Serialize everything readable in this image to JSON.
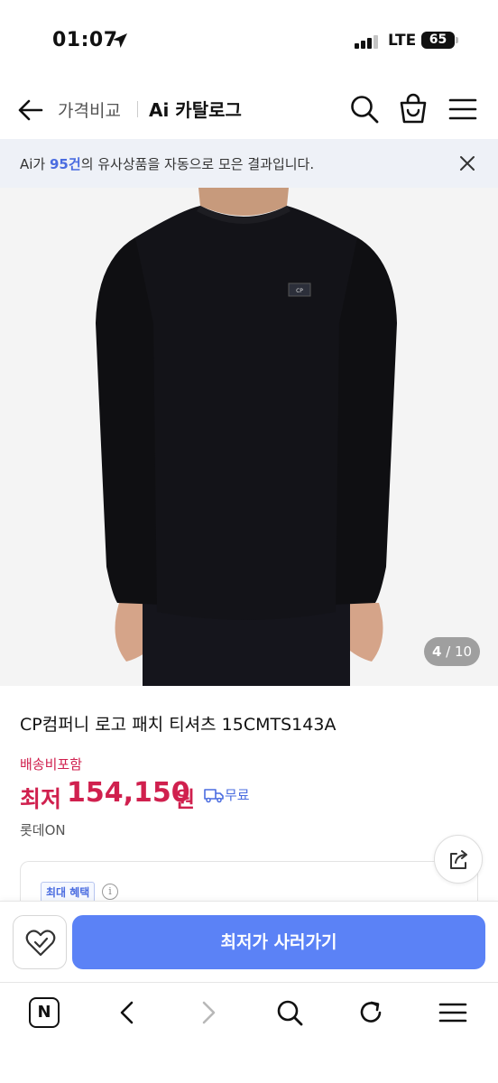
{
  "status_bar": {
    "time": "01:07",
    "network": "LTE",
    "battery": "65"
  },
  "header": {
    "tab_price_compare": "가격비교",
    "tab_ai_catalog": "Ai 카탈로그"
  },
  "banner": {
    "prefix": "Ai가 ",
    "count": "95건",
    "suffix": "의 유사상품을 자동으로 모은 결과입니다."
  },
  "image_counter": {
    "current": "4",
    "separator": " / ",
    "total": "10"
  },
  "product": {
    "title": "CP컴퍼니 로고 패치 티셔츠 15CMTS143A",
    "shipping_label": "배송비포함",
    "price_prefix": "최저",
    "price_value": "154,150",
    "price_unit": "원",
    "shipping_fee": "무료",
    "seller": "롯데ON"
  },
  "benefit": {
    "badge": "최대 혜택",
    "info_glyph": "i"
  },
  "actions": {
    "buy_label": "최저가 사러가기"
  },
  "browser_toolbar": {
    "home_glyph": "N"
  },
  "colors": {
    "price_red": "#d0204e",
    "accent_blue": "#5b82f6",
    "banner_bg": "#eef1f7"
  }
}
